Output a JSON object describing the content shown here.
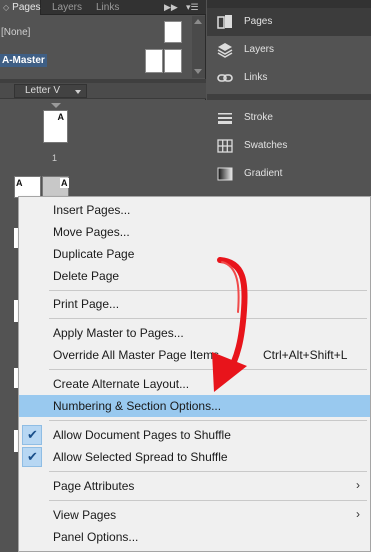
{
  "pages_panel": {
    "tabs": [
      {
        "label": "Pages",
        "active": true
      },
      {
        "label": "Layers",
        "active": false
      },
      {
        "label": "Links",
        "active": false
      }
    ],
    "masters": [
      {
        "label": "[None]",
        "selected": false
      },
      {
        "label": "A-Master",
        "selected": true
      }
    ],
    "page_size": "Letter V",
    "pages": [
      {
        "number": "1",
        "master_letter": "A"
      },
      {
        "master_letter_left": "A",
        "master_letter_right": "A"
      }
    ]
  },
  "dock": {
    "items": [
      {
        "label": "Pages",
        "icon": "pages-icon",
        "active": true
      },
      {
        "label": "Layers",
        "icon": "layers-icon",
        "active": false
      },
      {
        "label": "Links",
        "icon": "links-icon",
        "active": false
      },
      {
        "label": "Stroke",
        "icon": "stroke-icon",
        "active": false
      },
      {
        "label": "Swatches",
        "icon": "swatches-icon",
        "active": false
      },
      {
        "label": "Gradient",
        "icon": "gradient-icon",
        "active": false
      }
    ]
  },
  "menu": {
    "items": [
      {
        "label": "Insert Pages..."
      },
      {
        "label": "Move Pages..."
      },
      {
        "label": "Duplicate Page"
      },
      {
        "label": "Delete Page"
      },
      {
        "label": "Print Page..."
      },
      {
        "label": "Apply Master to Pages..."
      },
      {
        "label": "Override All Master Page Items",
        "shortcut": "Ctrl+Alt+Shift+L"
      },
      {
        "label": "Create Alternate Layout..."
      },
      {
        "label": "Numbering & Section Options...",
        "highlighted": true
      },
      {
        "label": "Allow Document Pages to Shuffle",
        "checked": true
      },
      {
        "label": "Allow Selected Spread to Shuffle",
        "checked": true
      },
      {
        "label": "Page Attributes",
        "submenu": true
      },
      {
        "label": "View Pages",
        "submenu": true
      },
      {
        "label": "Panel Options..."
      }
    ],
    "submenu_glyph": "›",
    "check_glyph": "✔"
  },
  "colors": {
    "menu_highlight": "#99c9ef",
    "annotation_arrow": "#e8141b",
    "panel_bg": "#535353"
  }
}
